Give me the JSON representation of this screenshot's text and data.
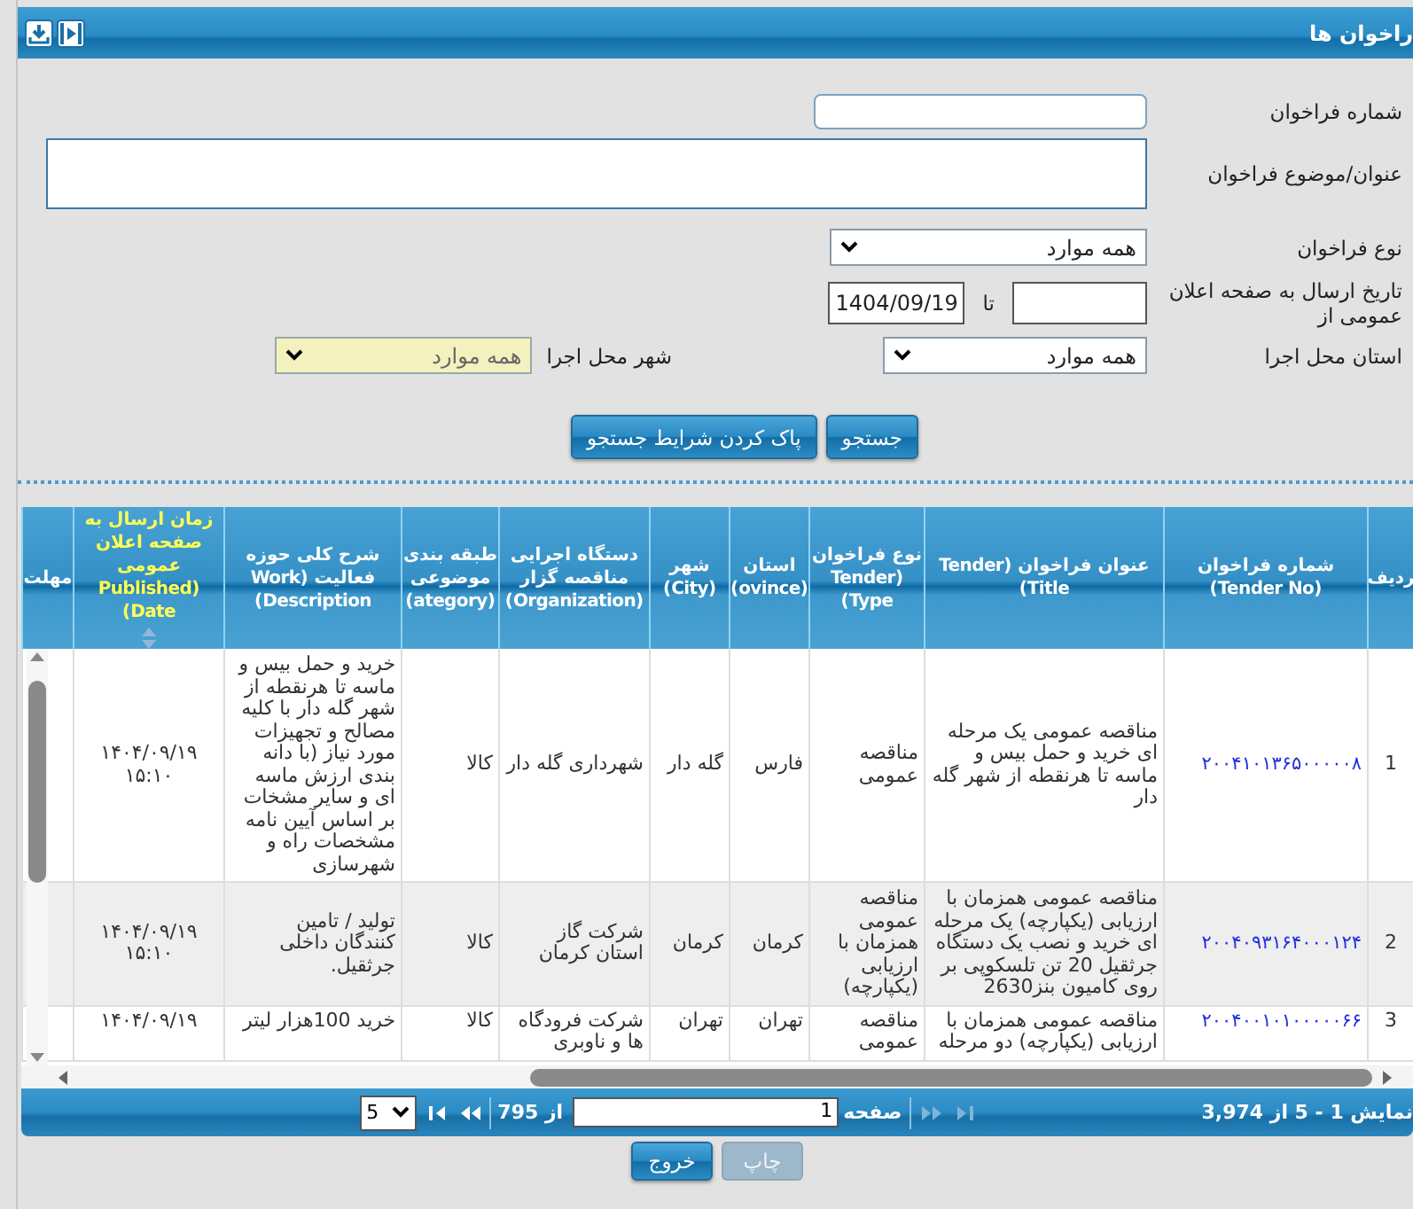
{
  "header": {
    "title": "راخوان ها"
  },
  "form": {
    "tender_no": {
      "label": "شماره فراخوان"
    },
    "subject": {
      "label": "عنوان/موضوع فراخوان"
    },
    "type": {
      "label": "نوع فراخوان",
      "value": "همه موارد"
    },
    "date": {
      "label": "تاریخ ارسال به صفحه اعلان عمومی از",
      "to_label": "تا",
      "to_value": "1404/09/19"
    },
    "province": {
      "label": "استان محل اجرا",
      "value": "همه موارد"
    },
    "city": {
      "label": "شهر محل اجرا",
      "value": "همه موارد",
      "disabled": true
    }
  },
  "buttons": [
    {
      "label": "جستجو"
    },
    {
      "label": "پاک کردن شرایط جستجو"
    }
  ],
  "table": {
    "columns": [
      {
        "label": "ردیف",
        "kind": "text",
        "sorted": false
      },
      {
        "label": "شماره فراخوان (Tender No)",
        "kind": "link",
        "sorted": false
      },
      {
        "label": "عنوان فراخوان (Tender Title)",
        "kind": "text",
        "sorted": false
      },
      {
        "label": "نوع فراخوان (Tender Type)",
        "kind": "text",
        "sorted": false
      },
      {
        "label": "استان (ovince)",
        "kind": "text",
        "sorted": false
      },
      {
        "label": "شهر (City)",
        "kind": "text",
        "sorted": false
      },
      {
        "label": "دستگاه اجرایی مناقصه گزار (Organization)",
        "kind": "text",
        "sorted": false
      },
      {
        "label": "طبقه بندی موضوعی (ategory)",
        "kind": "text",
        "sorted": false
      },
      {
        "label": "شرح کلی حوزه فعالیت (Work Description)",
        "kind": "text",
        "sorted": false
      },
      {
        "label": "زمان ارسال به صفحه اعلان عمومی (Published Date)",
        "kind": "text",
        "sorted": true
      },
      {
        "label": "مهلت",
        "sorted": false
      }
    ],
    "rows": [
      {
        "cells": [
          "1",
          "۲۰۰۴۱۰۱۳۶۵۰۰۰۰۰۸",
          "مناقصه عمومی یک مرحله ای خرید و حمل بیس و ماسه تا هرنقطه از شهر گله دار",
          "مناقصه عمومی",
          "فارس",
          "گله دار",
          "شهرداری گله دار",
          "کالا",
          "خرید و حمل بیس و ماسه تا هرنقطه از شهر گله دار با کلیه مصالح و تجهیزات مورد نیاز (با دانه بندی ارزش ماسه ای و سایر مشخات بر اساس آیین نامه مشخصات راه و شهرسازی",
          "۱۴۰۴/۰۹/۱۹ ۱۵:۱۰"
        ]
      },
      {
        "cells": [
          "2",
          "۲۰۰۴۰۹۳۱۶۴۰۰۰۱۲۴",
          "مناقصه عمومی همزمان با ارزیابی (یکپارچه) یک مرحله ای خرید و نصب یک دستگاه جرثقیل 20 تن تلسکوپی بر روی کامیون بنز2630",
          "مناقصه عمومی همزمان با ارزیابی (یکپارچه)",
          "کرمان",
          "کرمان",
          "شرکت گاز استان کرمان",
          "کالا",
          "تولید / تامین کنندگان داخلی جرثقیل.",
          "۱۴۰۴/۰۹/۱۹ ۱۵:۱۰"
        ]
      },
      {
        "cells": [
          "3",
          "۲۰۰۴۰۰۱۰۱۰۰۰۰۰۶۶",
          "مناقصه عمومی همزمان با ارزیابی (یکپارچه) دو مرحله",
          "مناقصه عمومی",
          "تهران",
          "تهران",
          "شرکت فرودگاه ها و ناوبری",
          "کالا",
          "خرید 100هزار لیتر",
          "۱۴۰۴/۰۹/۱۹"
        ]
      }
    ]
  },
  "pager": {
    "summary": "نمایش 1 - 5 از 3,974",
    "page_label": "صفحه",
    "page": "1",
    "of": "از 795",
    "page_size": "5"
  },
  "actions": [
    {
      "label": "چاپ",
      "disabled": true
    },
    {
      "label": "خروج",
      "disabled": false
    }
  ]
}
